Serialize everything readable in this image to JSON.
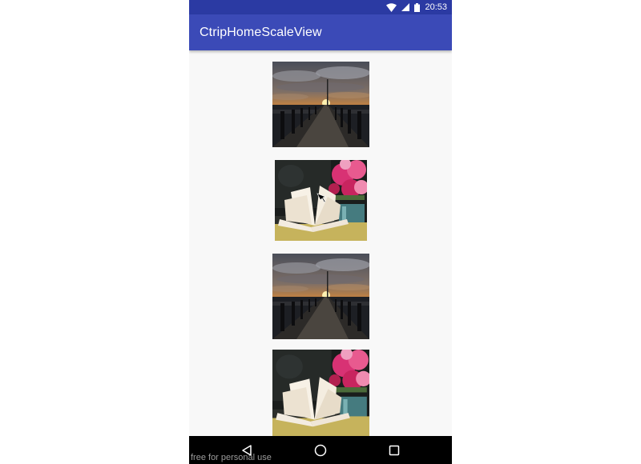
{
  "status_bar": {
    "time": "20:53",
    "icons": [
      "wifi-icon",
      "signal-icon",
      "battery-icon"
    ],
    "color": "#2b3aa3"
  },
  "app_bar": {
    "title": "CtripHomeScaleView",
    "color": "#3b4ab7"
  },
  "content": {
    "images": [
      {
        "subject": "pier-sunset"
      },
      {
        "subject": "open-book-flowers"
      },
      {
        "subject": "pier-sunset"
      },
      {
        "subject": "open-book-flowers"
      }
    ]
  },
  "nav_bar": {
    "buttons": [
      "back-icon",
      "home-icon",
      "recents-icon"
    ]
  },
  "watermark": "free for personal use"
}
